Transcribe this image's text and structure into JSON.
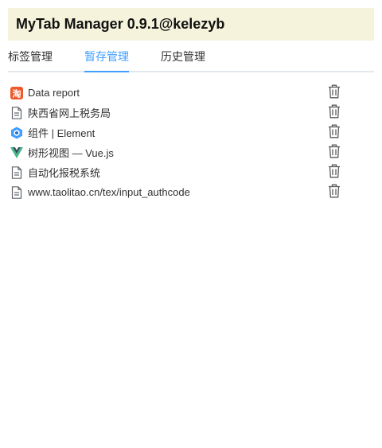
{
  "header": {
    "title": "MyTab Manager 0.9.1@kelezyb"
  },
  "tabs": [
    {
      "label": "标签管理",
      "active": false
    },
    {
      "label": "暂存管理",
      "active": true
    },
    {
      "label": "历史管理",
      "active": false
    }
  ],
  "items": [
    {
      "title": "Data report",
      "icon": "taobao-icon"
    },
    {
      "title": "陕西省网上税务局",
      "icon": "document-icon"
    },
    {
      "title": "组件 | Element",
      "icon": "element-icon"
    },
    {
      "title": "树形视图 — Vue.js",
      "icon": "vue-icon"
    },
    {
      "title": "自动化报税系统",
      "icon": "document-icon"
    },
    {
      "title": "www.taolitao.cn/tex/input_authcode",
      "icon": "document-icon"
    }
  ],
  "colors": {
    "header_bg": "#f5f3dc",
    "active_tab": "#409eff",
    "text": "#303133"
  }
}
